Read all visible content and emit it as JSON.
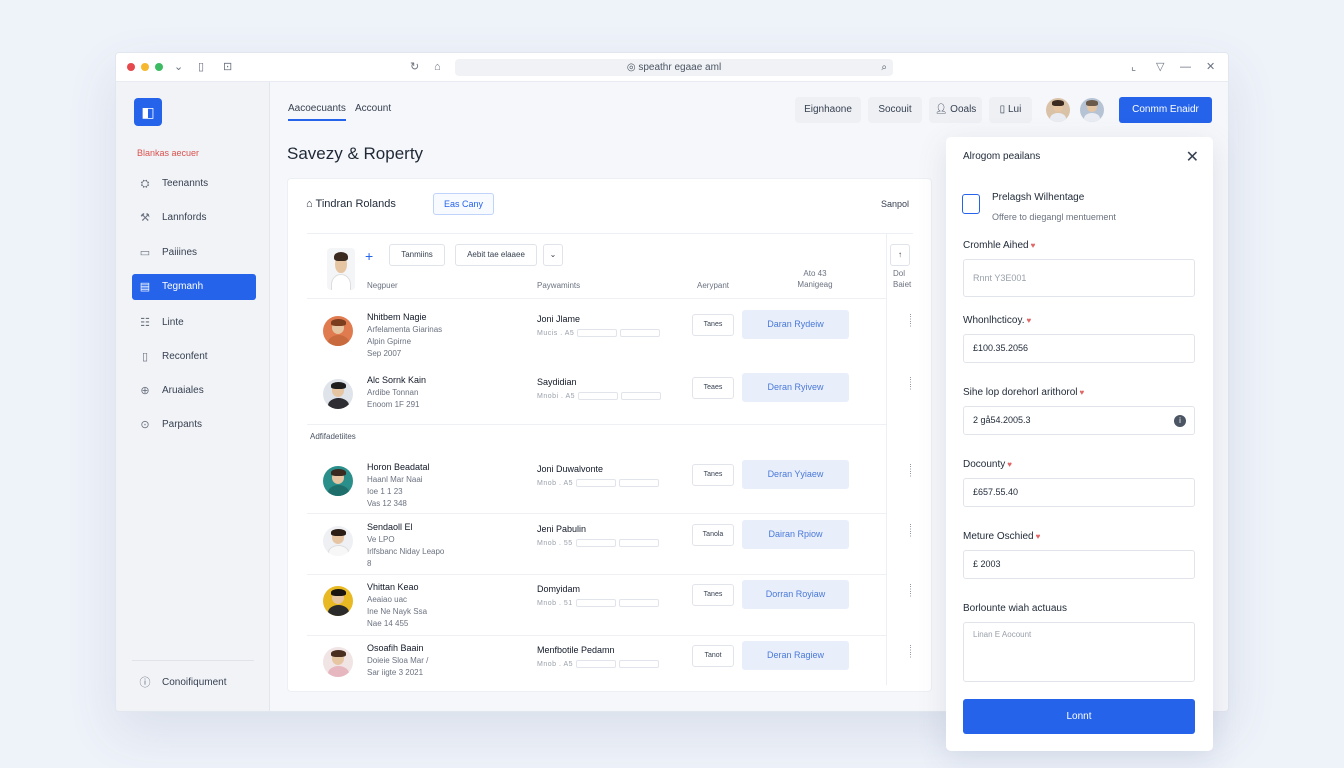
{
  "browser": {
    "url": "speathr egaae aml",
    "colors": {
      "close": "#e5484d",
      "minimize": "#f5b82e",
      "maximize": "#3dbb62"
    }
  },
  "sidebar": {
    "section_label": "Blankas aecuer",
    "items": [
      {
        "label": "Teenannts",
        "icon": "users-icon",
        "active": false
      },
      {
        "label": "Lannfords",
        "icon": "hammer-icon",
        "active": false
      },
      {
        "label": "Paiiines",
        "icon": "card-icon",
        "active": false
      },
      {
        "label": "Tegmanh",
        "icon": "table-icon",
        "active": true
      },
      {
        "label": "Linte",
        "icon": "list-icon",
        "active": false
      },
      {
        "label": "Reconfent",
        "icon": "file-icon",
        "active": false
      },
      {
        "label": "Aruaiales",
        "icon": "globe-icon",
        "active": false
      },
      {
        "label": "Parpants",
        "icon": "settings-icon",
        "active": false
      }
    ],
    "footer_label": "Conoifiqument"
  },
  "header": {
    "tabs": [
      {
        "label": "Aacoecuants",
        "active": true
      },
      {
        "label": "Account",
        "active": false
      }
    ],
    "buttons": [
      "Eignhaone",
      "Socouit",
      "Ooals",
      "Lui"
    ],
    "primary_button": "Conmm Enaidr"
  },
  "page_title": "Savezy & Roperty",
  "card": {
    "title": "Tindran Rolands",
    "badge_button": "Eas Cany",
    "link": "Sanpol",
    "toolbar": {
      "button1": "Tanmiins",
      "button2": "Aebit tae elaaee"
    },
    "columns": {
      "tenant": "Negpuer",
      "property": "Paywamints",
      "amount": "Aerypant",
      "status": "Ato 43 Manigeag",
      "extra": "Dol Baiet"
    },
    "group_label": "Adfifadetiites",
    "rows": [
      {
        "name": "Nhitbem Nagie",
        "sub": [
          "Arfelamenta Giarinas",
          "Alpin Gpirne",
          "Sep 2007"
        ],
        "property": "Joni Jlame",
        "meta": "Mucis . A5",
        "stat": "Tanes",
        "action": "Daran Rydeiw"
      },
      {
        "name": "Alc Sornk Kain",
        "sub": [
          "Ardibe Tonnan",
          "Enoom 1F 291"
        ],
        "property": "Saydidian",
        "meta": "Mnobi . A5",
        "stat": "Teaes",
        "action": "Deran Ryivew"
      },
      {
        "name": "Horon Beadatal",
        "sub": [
          "Haanl Mar Naai",
          "Ioe 1 1 23",
          "Vas 12 348"
        ],
        "property": "Joni Duwalvonte",
        "meta": "Mnob . A5",
        "stat": "Tanes",
        "action": "Deran Yyiaew"
      },
      {
        "name": "Sendaoll El",
        "sub": [
          "Ve LPO",
          "Irlfsbanc Niday Leapo",
          "8"
        ],
        "property": "Jeni Pabulin",
        "meta": "Mnob . 55",
        "stat": "Tanola",
        "action": "Dairan Rpiow"
      },
      {
        "name": "Vhittan Keao",
        "sub": [
          "Aeaiao uac",
          "Ine Ne Nayk Ssa",
          "Nae 14 455"
        ],
        "property": "Domyidam",
        "meta": "Mnob . 51",
        "stat": "Tanes",
        "action": "Dorran Royiaw"
      },
      {
        "name": "Osoafih Baain",
        "sub": [
          "Doieie Sloa Mar /",
          "Sar iigte 3 2021"
        ],
        "property": "Menfbotile Pedamn",
        "meta": "Mnob . A5",
        "stat": "Tanot",
        "action": "Deran Ragiew"
      }
    ]
  },
  "panel": {
    "title": "Alrogom peailans",
    "checkbox_title": "Prelagsh Wilhentage",
    "checkbox_sub": "Offere to diegangl mentuement",
    "fields": [
      {
        "label": "Cromhle Aihed",
        "value": "Rnnt Y3E001",
        "placeholder": true
      },
      {
        "label": "Whonlhcticoy.",
        "value": "£100.35.2056",
        "placeholder": false
      },
      {
        "label": "Sihe lop dorehorl arithorol",
        "value": "2 gå54.2005.3",
        "placeholder": false
      },
      {
        "label": "Docounty",
        "value": "£657.55.40",
        "placeholder": false
      },
      {
        "label": "Meture Oschied",
        "value": "£ 2003",
        "placeholder": false
      }
    ],
    "textarea_label": "Borlounte wiah actuaus",
    "textarea_placeholder": "Linan E Aocount",
    "submit": "Lonnt"
  }
}
